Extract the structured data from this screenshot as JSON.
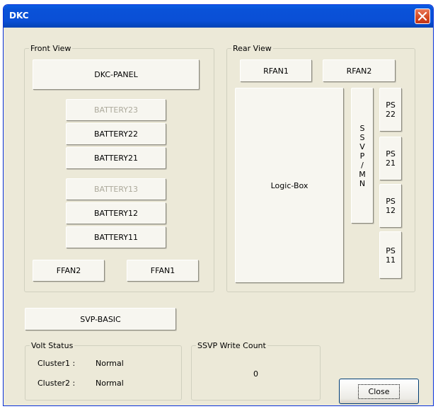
{
  "window": {
    "title": "DKC"
  },
  "front_view": {
    "legend": "Front View",
    "dkc_panel": "DKC-PANEL",
    "batteries": [
      {
        "label": "BATTERY23",
        "enabled": false
      },
      {
        "label": "BATTERY22",
        "enabled": true
      },
      {
        "label": "BATTERY21",
        "enabled": true
      },
      {
        "label": "BATTERY13",
        "enabled": false
      },
      {
        "label": "BATTERY12",
        "enabled": true
      },
      {
        "label": "BATTERY11",
        "enabled": true
      }
    ],
    "ffan2": "FFAN2",
    "ffan1": "FFAN1"
  },
  "rear_view": {
    "legend": "Rear View",
    "rfan1": "RFAN1",
    "rfan2": "RFAN2",
    "logic_box": "Logic-Box",
    "ssvp_mn": [
      "S",
      "S",
      "V",
      "P",
      "/",
      "M",
      "N"
    ],
    "ps22": [
      "PS",
      "22"
    ],
    "ps21": [
      "PS",
      "21"
    ],
    "ps12": [
      "PS",
      "12"
    ],
    "ps11": [
      "PS",
      "11"
    ]
  },
  "svp_basic": "SVP-BASIC",
  "volt_status": {
    "legend": "Volt Status",
    "cluster1_label": "Cluster1 :",
    "cluster1_value": "Normal",
    "cluster2_label": "Cluster2 :",
    "cluster2_value": "Normal"
  },
  "ssvp_write_count": {
    "legend": "SSVP Write Count",
    "value": "0"
  },
  "close_button": {
    "label": "Close"
  },
  "colors": {
    "title_bar": "#0a52d8",
    "dialog_bg": "#ece9d8",
    "close_icon_bg": "#d4471f"
  }
}
